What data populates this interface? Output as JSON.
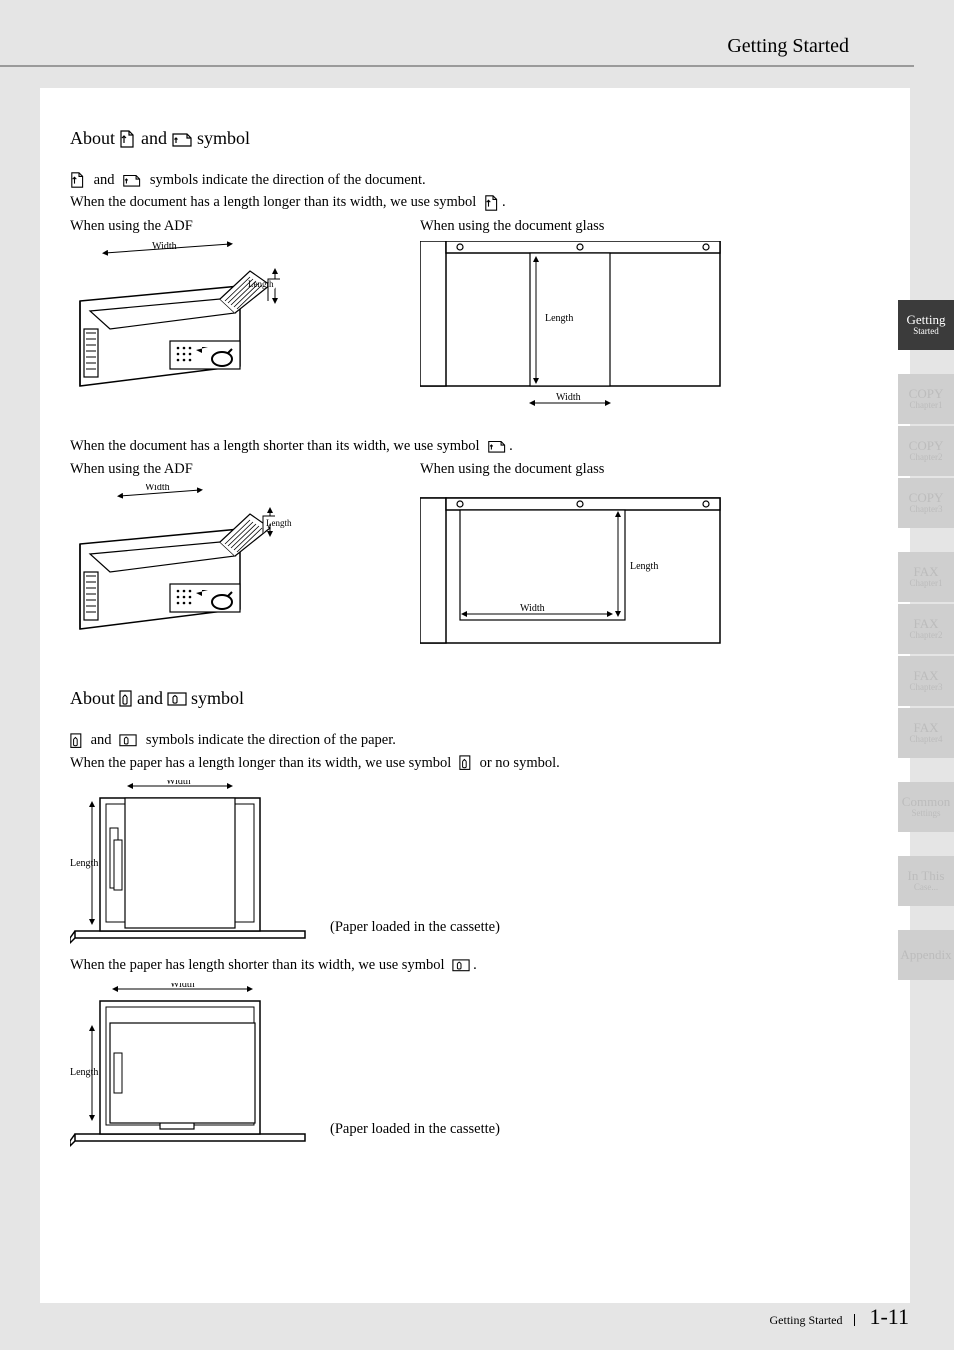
{
  "header": {
    "title": "Getting Started"
  },
  "section1": {
    "heading_prefix": "About",
    "heading_and": "and",
    "heading_suffix": "symbol",
    "line1_p1": "and",
    "line1_p2": "symbols indicate the direction of the document.",
    "line2_p1": "When the document has a length longer than its width, we use symbol",
    "line2_p2": ".",
    "adf_label": "When using the ADF",
    "glass_label": "When using the document glass",
    "line3_p1": "When the document has a length shorter than its width, we use symbol",
    "line3_p2": "."
  },
  "labels": {
    "width": "Width",
    "length": "Length"
  },
  "section2": {
    "heading_prefix": "About",
    "heading_and": "and",
    "heading_suffix": "symbol",
    "line1_p1": "and",
    "line1_p2": "symbols indicate the direction of the paper.",
    "line2_p1": "When the paper has a length longer than its width, we use symbol",
    "line2_p2": "or no symbol.",
    "cassette_note": "(Paper loaded in the cassette)",
    "line3_p1": "When the paper has length shorter than its width, we use symbol",
    "line3_p2": "."
  },
  "tabs": [
    {
      "main": "Getting",
      "sub": "Started",
      "active": true
    },
    {
      "main": "COPY",
      "sub": "Chapter1",
      "active": false
    },
    {
      "main": "COPY",
      "sub": "Chapter2",
      "active": false
    },
    {
      "main": "COPY",
      "sub": "Chapter3",
      "active": false
    },
    {
      "main": "FAX",
      "sub": "Chapter1",
      "active": false
    },
    {
      "main": "FAX",
      "sub": "Chapter2",
      "active": false
    },
    {
      "main": "FAX",
      "sub": "Chapter3",
      "active": false
    },
    {
      "main": "FAX",
      "sub": "Chapter4",
      "active": false
    },
    {
      "main": "Common",
      "sub": "Settings",
      "active": false
    },
    {
      "main": "In This",
      "sub": "Case...",
      "active": false
    },
    {
      "main": "Appendix",
      "sub": "",
      "active": false
    }
  ],
  "footer": {
    "section": "Getting Started",
    "page": "1-11"
  }
}
